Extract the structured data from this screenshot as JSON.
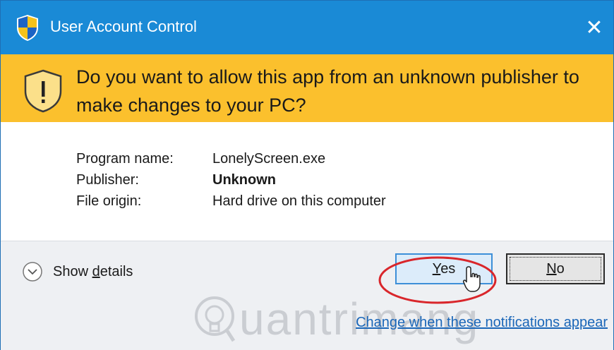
{
  "titlebar": {
    "title": "User Account Control",
    "close_symbol": "✕",
    "icon": "uac-shield-icon"
  },
  "banner": {
    "question": "Do you want to allow this app from an unknown publisher to make changes to your PC?",
    "icon": "warning-shield-icon"
  },
  "info": {
    "rows": [
      {
        "label": "Program name:",
        "value": "LonelyScreen.exe"
      },
      {
        "label": "Publisher:",
        "value": "Unknown"
      },
      {
        "label": "File origin:",
        "value": "Hard drive on this computer"
      }
    ]
  },
  "footer": {
    "details_prefix": "Show ",
    "details_underlined": "d",
    "details_suffix": "etails",
    "yes_underlined": "Y",
    "yes_rest": "es",
    "no_underlined": "N",
    "no_rest": "o",
    "notifications_link": "Change when these notifications appear"
  },
  "watermark": {
    "text": "uantrimang"
  },
  "colors": {
    "titlebar": "#1a8ad6",
    "banner": "#fbc02d",
    "footer": "#eef0f3",
    "link": "#1a66b8",
    "highlight_oval": "#d9262b"
  }
}
